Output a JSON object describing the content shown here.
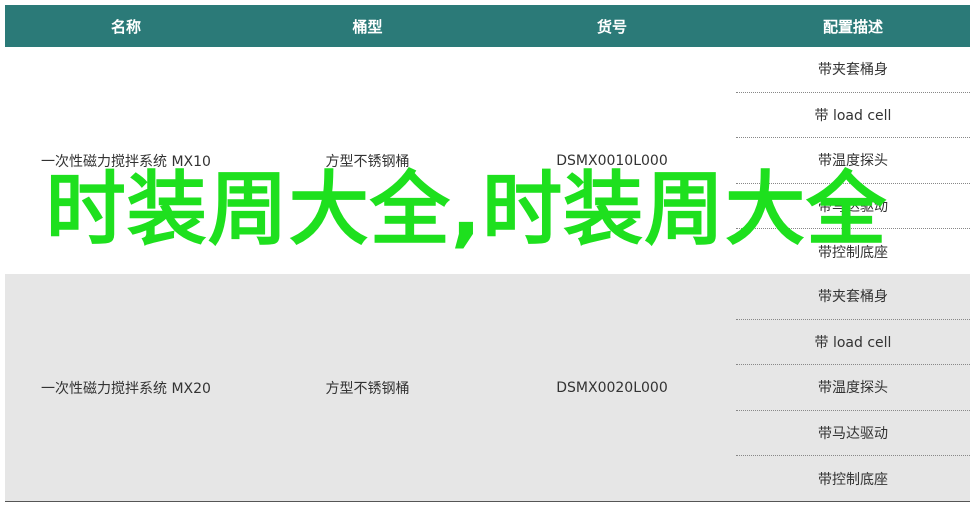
{
  "headers": [
    "名称",
    "桶型",
    "货号",
    "配置描述"
  ],
  "rows": [
    {
      "name": "一次性磁力搅拌系统 MX10",
      "type": "方型不锈钢桶",
      "sku": "DSMX0010L000",
      "configs": [
        "带夹套桶身",
        "带 load cell",
        "带温度探头",
        "带马达驱动",
        "带控制底座"
      ]
    },
    {
      "name": "一次性磁力搅拌系统 MX20",
      "type": "方型不锈钢桶",
      "sku": "DSMX0020L000",
      "configs": [
        "带夹套桶身",
        "带 load cell",
        "带温度探头",
        "带马达驱动",
        "带控制底座"
      ]
    }
  ],
  "overlay_title": "时装周大全,时装周大全",
  "colors": {
    "header_bg": "#2b7a78",
    "overlay_text": "#1ee01e",
    "alt_row_bg": "#e6e6e6"
  }
}
